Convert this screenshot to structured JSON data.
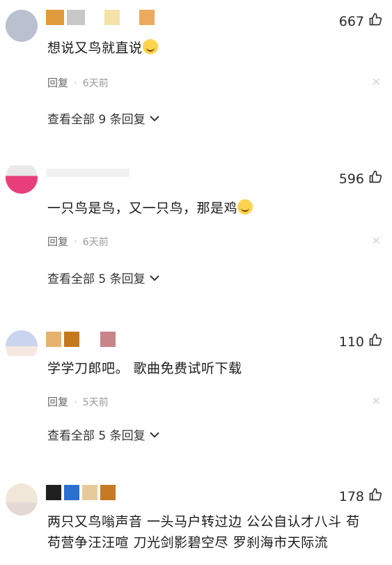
{
  "comments": [
    {
      "likes": "667",
      "text": "想说又鸟就直说",
      "reply_label": "回复",
      "time": "6天前",
      "view_replies": "查看全部 9 条回复",
      "avatar_color": "#b7bfd0"
    },
    {
      "likes": "596",
      "text": "一只鸟是鸟，又一只鸟，那是鸡",
      "reply_label": "回复",
      "time": "6天前",
      "view_replies": "查看全部 5 条回复",
      "avatar_color": "#e83f7a"
    },
    {
      "likes": "110",
      "text": "学学刀郎吧。 歌曲免费试听下载",
      "reply_label": "回复",
      "time": "5天前",
      "view_replies": "查看全部 5 条回复",
      "avatar_color": "#c9d5ef"
    },
    {
      "likes": "178",
      "text_line1": "两只又鸟嗡声音 一头马户转过边 公公自认才八斗 苟",
      "text_line2": "苟营争汪汪喧 刀光剑影碧空尽 罗刹海市天际流",
      "avatar_color": "#f1e7d8"
    }
  ],
  "icons": {
    "like": "thumbs-up-icon",
    "close": "close-icon",
    "chevron": "chevron-down-icon",
    "emoji": "laugh-emoji-icon"
  }
}
